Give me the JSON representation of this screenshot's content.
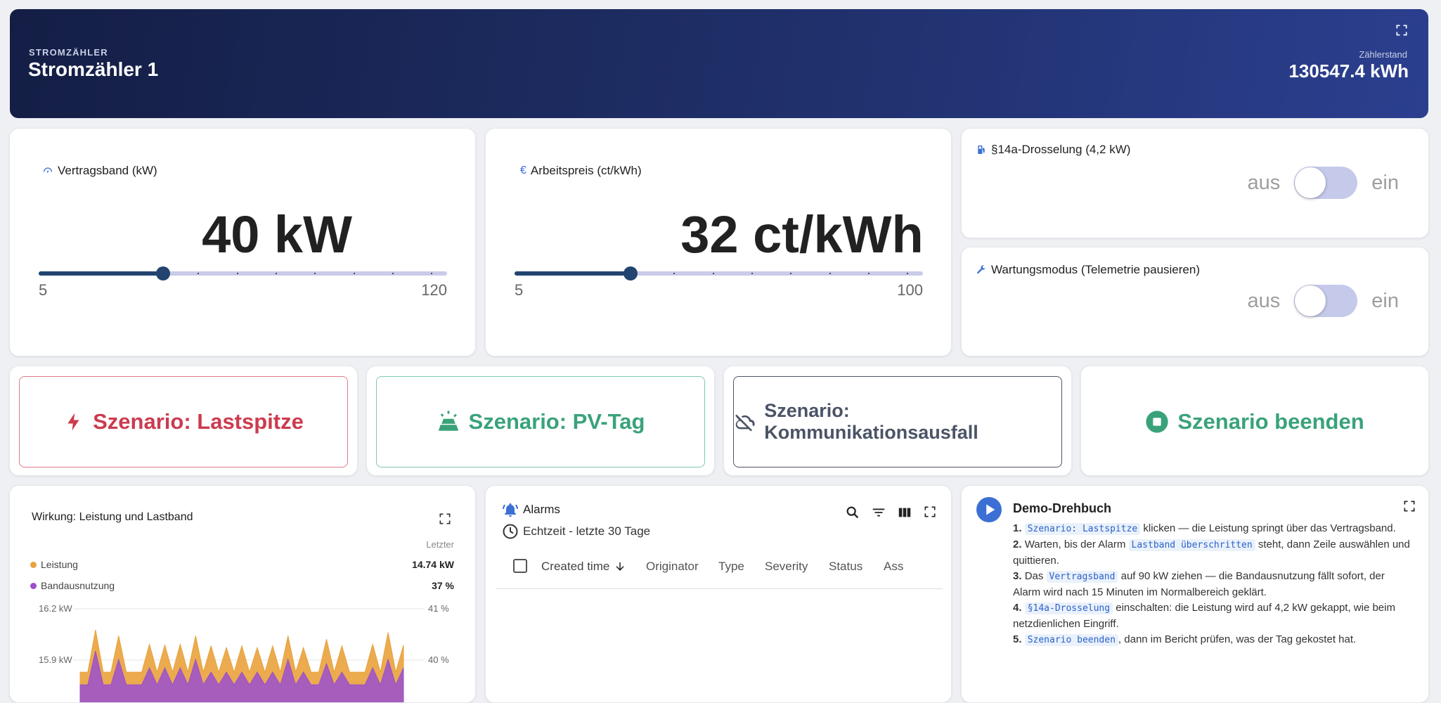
{
  "header": {
    "type_label": "STROMZÄHLER",
    "name": "Stromzähler 1",
    "reading_label": "Zählerstand",
    "reading_value": "130547.4 kWh",
    "gradient_colors": [
      "#141e45",
      "#2b3f8f"
    ]
  },
  "vertragsband": {
    "title": "Vertragsband (kW)",
    "value_text": "40 kW",
    "min": "5",
    "max": "120",
    "value": 40,
    "range": [
      5,
      120
    ]
  },
  "arbeitspreis": {
    "title": "Arbeitspreis (ct/kWh)",
    "value_text": "32 ct/kWh",
    "min": "5",
    "max": "100",
    "value": 32,
    "range": [
      5,
      100
    ]
  },
  "drosselung": {
    "title": "§14a-Drosselung (4,2 kW)",
    "off_label": "aus",
    "on_label": "ein",
    "state": false
  },
  "wartung": {
    "title": "Wartungsmodus (Telemetrie pausieren)",
    "off_label": "aus",
    "on_label": "ein",
    "state": false
  },
  "scenarios": {
    "lastspitze": "Szenario: Lastspitze",
    "pv_tag": "Szenario: PV-Tag",
    "kommunikationsausfall": "Szenario: Kommunikationsausfall",
    "beenden": "Szenario beenden",
    "colors": {
      "lastspitze": "#cc3b4f",
      "pv_tag": "#3aa27a",
      "komm": "#4b5466",
      "beenden": "#3aa27a"
    }
  },
  "chart": {
    "title": "Wirkung: Leistung und Lastband",
    "legend_header": "Letzter",
    "legend": [
      {
        "name": "Leistung",
        "value": "14.74 kW",
        "color": "#e9a23b"
      },
      {
        "name": "Bandausnutzung",
        "value": "37 %",
        "color": "#9b4fcf"
      }
    ],
    "y_left": [
      "16.2 kW",
      "15.9 kW"
    ],
    "y_right": [
      "41 %",
      "40 %"
    ]
  },
  "chart_data": {
    "type": "area",
    "title": "Wirkung: Leistung und Lastband",
    "series": [
      {
        "name": "Leistung",
        "color": "#e9a23b",
        "values": [
          15.45,
          15.45,
          15.95,
          15.45,
          15.45,
          15.88,
          15.45,
          15.45,
          15.45,
          15.78,
          15.45,
          15.77,
          15.45,
          15.78,
          15.45,
          15.88,
          15.45,
          15.76,
          15.45,
          15.74,
          15.45,
          15.76,
          15.45,
          15.74,
          15.45,
          15.76,
          15.45,
          15.88,
          15.45,
          15.74,
          15.45,
          15.45,
          15.84,
          15.45,
          15.76,
          15.45,
          15.45,
          15.45,
          15.78,
          15.45,
          15.92,
          15.45,
          15.77
        ]
      },
      {
        "name": "Bandausnutzung",
        "color": "#9b4fcf",
        "values": [
          39.5,
          39.5,
          40.3,
          39.5,
          39.5,
          40.1,
          39.5,
          39.5,
          39.5,
          39.9,
          39.5,
          39.9,
          39.5,
          39.9,
          39.5,
          40.1,
          39.5,
          39.8,
          39.5,
          39.8,
          39.5,
          39.8,
          39.5,
          39.8,
          39.5,
          39.8,
          39.5,
          40.1,
          39.5,
          39.8,
          39.5,
          39.5,
          40.0,
          39.5,
          39.8,
          39.5,
          39.5,
          39.5,
          39.9,
          39.5,
          40.1,
          39.5,
          39.9
        ]
      }
    ],
    "y_left_ticks": [
      "16.2 kW",
      "15.9 kW"
    ],
    "y_right_ticks": [
      "41 %",
      "40 %"
    ],
    "ylim_left": [
      15.4,
      16.2
    ],
    "ylim_right": [
      39.4,
      41
    ],
    "grid": true,
    "legend_position": "top-left"
  },
  "alarms": {
    "title": "Alarms",
    "timewindow": "Echtzeit - letzte 30 Tage",
    "columns": [
      "Created time",
      "Originator",
      "Type",
      "Severity",
      "Status",
      "Ass"
    ]
  },
  "drehbuch": {
    "title": "Demo-Drehbuch",
    "steps": [
      {
        "num": "1.",
        "parts": [
          {
            "code": "Szenario: Lastspitze"
          },
          {
            "text": " klicken — die Leistung springt über das Vertragsband."
          }
        ]
      },
      {
        "num": "2.",
        "parts": [
          {
            "text": "Warten, bis der Alarm "
          },
          {
            "code": "Lastband überschritten"
          },
          {
            "text": " steht, dann Zeile auswählen und quittieren."
          }
        ]
      },
      {
        "num": "3.",
        "parts": [
          {
            "text": "Das "
          },
          {
            "code": "Vertragsband"
          },
          {
            "text": " auf 90 kW ziehen — die Bandausnutzung fällt sofort, der Alarm wird nach 15 Minuten im Normalbereich geklärt."
          }
        ]
      },
      {
        "num": "4.",
        "parts": [
          {
            "code": "§14a-Drosselung"
          },
          {
            "text": " einschalten: die Leistung wird auf 4,2 kW gekappt, wie beim netzdienlichen Eingriff."
          }
        ]
      },
      {
        "num": "5.",
        "parts": [
          {
            "code": "Szenario beenden"
          },
          {
            "text": ", dann im Bericht prüfen, was der Tag gekostet hat."
          }
        ]
      }
    ]
  }
}
